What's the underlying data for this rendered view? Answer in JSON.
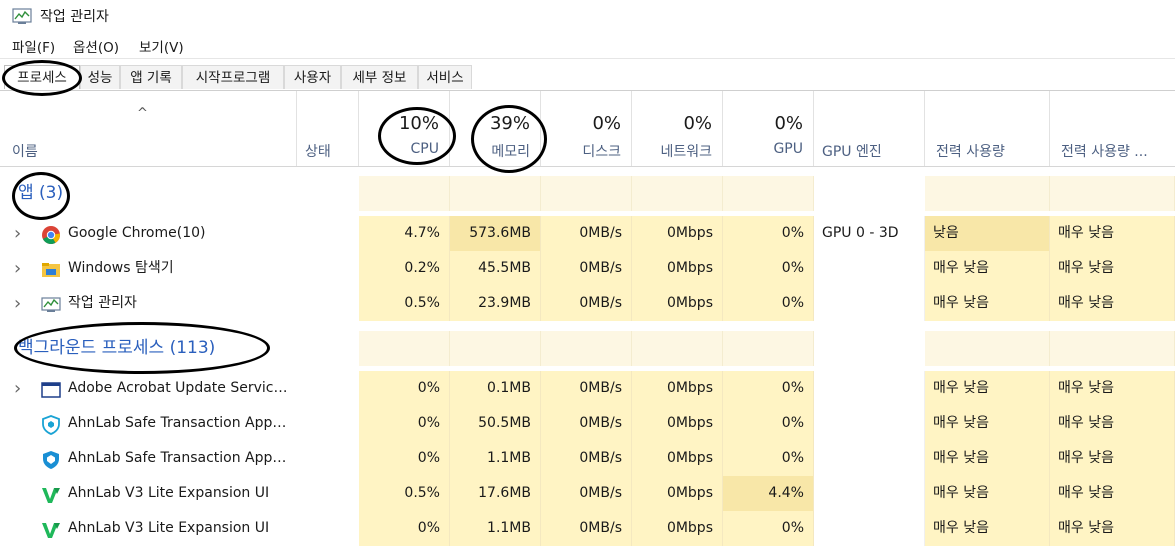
{
  "window": {
    "title": "작업 관리자",
    "icon": "task-manager-icon"
  },
  "menu": [
    "파일(F)",
    "옵션(O)",
    "보기(V)"
  ],
  "tabs": [
    {
      "label": "프로세스",
      "active": true
    },
    {
      "label": "성능"
    },
    {
      "label": "앱 기록"
    },
    {
      "label": "시작프로그램"
    },
    {
      "label": "사용자"
    },
    {
      "label": "세부 정보"
    },
    {
      "label": "서비스"
    }
  ],
  "columns": {
    "name": "이름",
    "status": "상태",
    "cpu": {
      "pct": "10%",
      "label": "CPU"
    },
    "memory": {
      "pct": "39%",
      "label": "메모리"
    },
    "disk": {
      "pct": "0%",
      "label": "디스크"
    },
    "network": {
      "pct": "0%",
      "label": "네트워크"
    },
    "gpu": {
      "pct": "0%",
      "label": "GPU"
    },
    "gpu_engine": "GPU 엔진",
    "power": "전력 사용량",
    "power_trend": "전력 사용량 ..."
  },
  "groups": {
    "apps": "앱 (3)",
    "background": "백그라운드 프로세스 (113)"
  },
  "apps": [
    {
      "name": "Google Chrome(10)",
      "icon": "chrome-icon",
      "cpu": "4.7%",
      "mem": "573.6MB",
      "disk": "0MB/s",
      "net": "0Mbps",
      "gpu": "0%",
      "engine": "GPU 0 - 3D",
      "power": "낮음",
      "trend": "매우 낮음"
    },
    {
      "name": "Windows 탐색기",
      "icon": "folder-icon",
      "cpu": "0.2%",
      "mem": "45.5MB",
      "disk": "0MB/s",
      "net": "0Mbps",
      "gpu": "0%",
      "engine": "",
      "power": "매우 낮음",
      "trend": "매우 낮음"
    },
    {
      "name": "작업 관리자",
      "icon": "task-manager-icon",
      "cpu": "0.5%",
      "mem": "23.9MB",
      "disk": "0MB/s",
      "net": "0Mbps",
      "gpu": "0%",
      "engine": "",
      "power": "매우 낮음",
      "trend": "매우 낮음"
    }
  ],
  "background": [
    {
      "name": "Adobe Acrobat Update Service...",
      "icon": "window-icon",
      "expand": true,
      "cpu": "0%",
      "mem": "0.1MB",
      "disk": "0MB/s",
      "net": "0Mbps",
      "gpu": "0%",
      "engine": "",
      "power": "매우 낮음",
      "trend": "매우 낮음"
    },
    {
      "name": "AhnLab Safe Transaction Appli...",
      "icon": "shield-outline-icon",
      "expand": false,
      "cpu": "0%",
      "mem": "50.5MB",
      "disk": "0MB/s",
      "net": "0Mbps",
      "gpu": "0%",
      "engine": "",
      "power": "매우 낮음",
      "trend": "매우 낮음"
    },
    {
      "name": "AhnLab Safe Transaction Appli...",
      "icon": "shield-filled-icon",
      "expand": false,
      "cpu": "0%",
      "mem": "1.1MB",
      "disk": "0MB/s",
      "net": "0Mbps",
      "gpu": "0%",
      "engine": "",
      "power": "매우 낮음",
      "trend": "매우 낮음"
    },
    {
      "name": "AhnLab V3 Lite Expansion UI",
      "icon": "v3-icon",
      "expand": false,
      "cpu": "0.5%",
      "mem": "17.6MB",
      "disk": "0MB/s",
      "net": "0Mbps",
      "gpu": "4.4%",
      "engine": "",
      "power": "매우 낮음",
      "trend": "매우 낮음"
    },
    {
      "name": "AhnLab V3 Lite Expansion UI",
      "icon": "v3-icon",
      "expand": false,
      "cpu": "0%",
      "mem": "1.1MB",
      "disk": "0MB/s",
      "net": "0Mbps",
      "gpu": "0%",
      "engine": "",
      "power": "매우 낮음",
      "trend": "매우 낮음"
    }
  ]
}
